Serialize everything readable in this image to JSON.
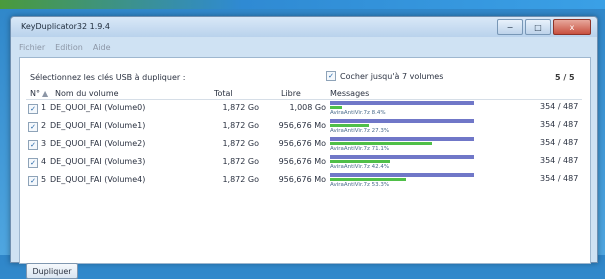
{
  "window": {
    "title": "KeyDuplicator32 1.9.4",
    "buttons": {
      "minimize": "−",
      "maximize": "□",
      "close": "x"
    }
  },
  "menu": [
    "Fichier",
    "Edition",
    "Aide"
  ],
  "panel": {
    "select_label": "Sélectionnez les clés USB à dupliquer :",
    "cocher_label": "Cocher jusqu'à 7 volumes",
    "cocher_checked": true,
    "counter": "5 / 5"
  },
  "table": {
    "headers": {
      "num": "N°",
      "name": "Nom du volume",
      "total": "Total",
      "libre": "Libre",
      "messages": "Messages"
    },
    "rows": [
      {
        "num": "1",
        "name": "DE_QUOI_FAI (Volume0)",
        "total": "1,872 Go",
        "libre": "1,008 Go",
        "message": "AviraAntiVir.7z 8.4%",
        "progress": 0.084,
        "count": "354 / 487"
      },
      {
        "num": "2",
        "name": "DE_QUOI_FAI (Volume1)",
        "total": "1,872 Go",
        "libre": "956,676 Mo",
        "message": "AviraAntiVir.7z 27.3%",
        "progress": 0.273,
        "count": "354 / 487"
      },
      {
        "num": "3",
        "name": "DE_QUOI_FAI (Volume2)",
        "total": "1,872 Go",
        "libre": "956,676 Mo",
        "message": "AviraAntiVir.7z 71.1%",
        "progress": 0.711,
        "count": "354 / 487"
      },
      {
        "num": "4",
        "name": "DE_QUOI_FAI (Volume3)",
        "total": "1,872 Go",
        "libre": "956,676 Mo",
        "message": "AviraAntiVir.7z 42.4%",
        "progress": 0.424,
        "count": "354 / 487"
      },
      {
        "num": "5",
        "name": "DE_QUOI_FAI (Volume4)",
        "total": "1,872 Go",
        "libre": "956,676 Mo",
        "message": "AviraAntiVir.7z 53.3%",
        "progress": 0.533,
        "count": "354 / 487"
      }
    ]
  },
  "actions": {
    "duplicate": "Dupliquer"
  },
  "colors": {
    "accent_blue": "#7077c8",
    "progress_green": "#4fbf48"
  }
}
